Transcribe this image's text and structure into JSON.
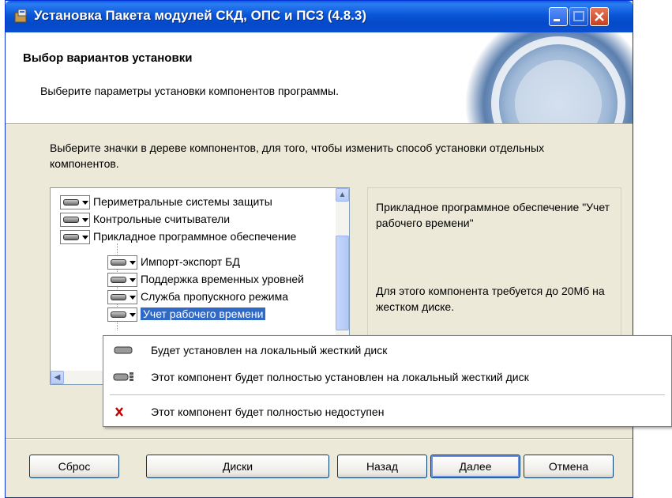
{
  "window": {
    "title": "Установка Пакета модулей СКД, ОПС и ПСЗ (4.8.3)",
    "accent": "#0a56d8"
  },
  "header": {
    "heading": "Выбор вариантов установки",
    "subheading": "Выберите параметры установки компонентов программы."
  },
  "instructions": "Выберите значки в дереве компонентов, для того, чтобы изменить способ установки отдельных компонентов.",
  "tree": {
    "items": [
      {
        "label": "Периметральные системы защиты",
        "icon": "hard-disk-icon"
      },
      {
        "label": "Контрольные считыватели",
        "icon": "hard-disk-icon"
      },
      {
        "label": "Прикладное программное обеспечение",
        "icon": "hard-disk-icon"
      },
      {
        "label": "Импорт-экспорт БД",
        "icon": "hard-disk-icon"
      },
      {
        "label": "Поддержка временных уровней",
        "icon": "hard-disk-icon"
      },
      {
        "label": "Служба пропускного режима",
        "icon": "hard-disk-icon"
      },
      {
        "label": "Учет рабочего времени",
        "icon": "hard-disk-icon",
        "selected": true
      }
    ]
  },
  "description": {
    "text": "Прикладное программное обеспечение \"Учет рабочего времени\"",
    "requirement": "Для этого компонента требуется до 20Мб на жестком диске."
  },
  "context_menu": {
    "items": [
      {
        "label": "Будет установлен на локальный жесткий диск",
        "icon": "hard-disk-icon"
      },
      {
        "label": "Этот компонент будет полностью установлен на локальный жесткий диск",
        "icon": "hard-disk-full-icon"
      },
      {
        "label": "Этот компонент будет полностью недоступен",
        "icon": "red-x-icon"
      }
    ]
  },
  "buttons": {
    "reset": "Сброс",
    "disks": "Диски",
    "back": "Назад",
    "next": "Далее",
    "cancel": "Отмена"
  }
}
